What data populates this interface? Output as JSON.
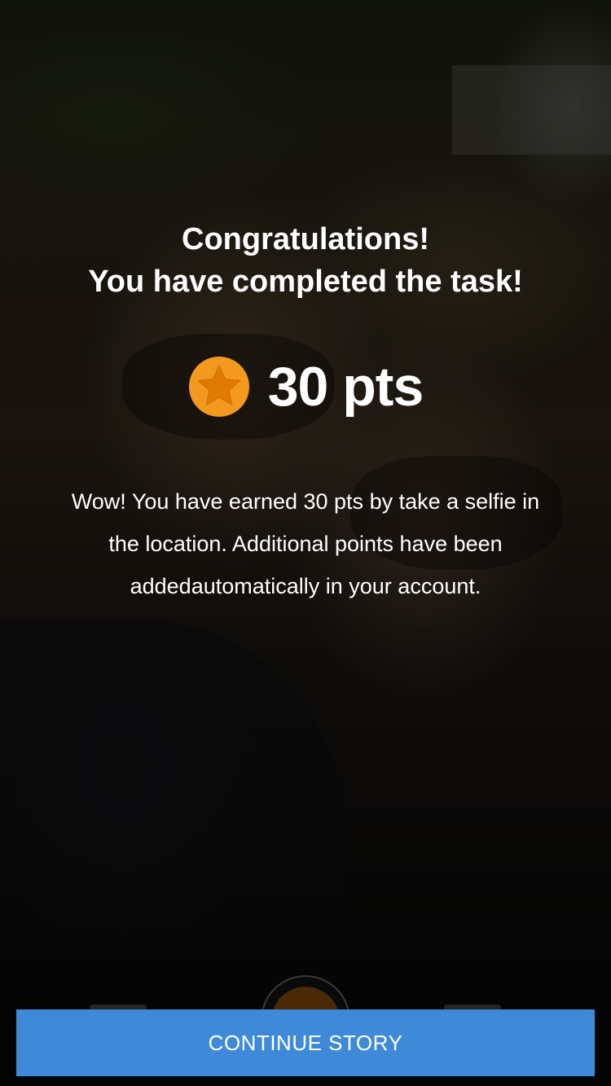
{
  "dialog": {
    "title_line1": "Congratulations!",
    "title_line2": "You have completed the task!",
    "points_label": "30 pts",
    "points_icon": "star-coin-icon",
    "message": "Wow! You have earned 30 pts by take a selfie in the location. Additional points have been addedautomatically in your account."
  },
  "actions": {
    "continue_label": "CONTINUE STORY"
  },
  "colors": {
    "accent_orange": "#f39a1e",
    "button_blue": "#3f8ad8",
    "text": "#ffffff"
  }
}
